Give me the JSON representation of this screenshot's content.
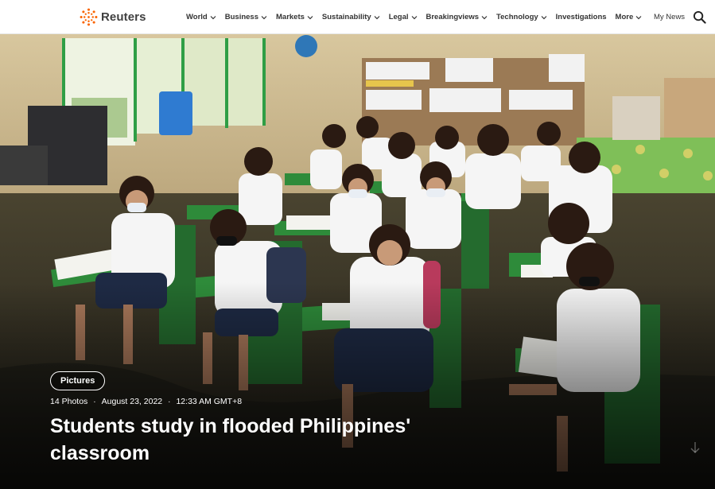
{
  "header": {
    "brand": "Reuters",
    "nav": [
      {
        "label": "World",
        "dropdown": true
      },
      {
        "label": "Business",
        "dropdown": true
      },
      {
        "label": "Markets",
        "dropdown": true
      },
      {
        "label": "Sustainability",
        "dropdown": true
      },
      {
        "label": "Legal",
        "dropdown": true
      },
      {
        "label": "Breakingviews",
        "dropdown": true
      },
      {
        "label": "Technology",
        "dropdown": true
      },
      {
        "label": "Investigations",
        "dropdown": false
      },
      {
        "label": "More",
        "dropdown": true
      }
    ],
    "my_news": "My News",
    "search_icon": "search-icon",
    "brand_color": "#fa6400"
  },
  "hero": {
    "badge": "Pictures",
    "photo_count": "14 Photos",
    "date": "August 23, 2022",
    "time": "12:33 AM GMT+8",
    "title": "Students study in flooded Philippines' classroom",
    "scroll_icon": "arrow-down-icon"
  }
}
